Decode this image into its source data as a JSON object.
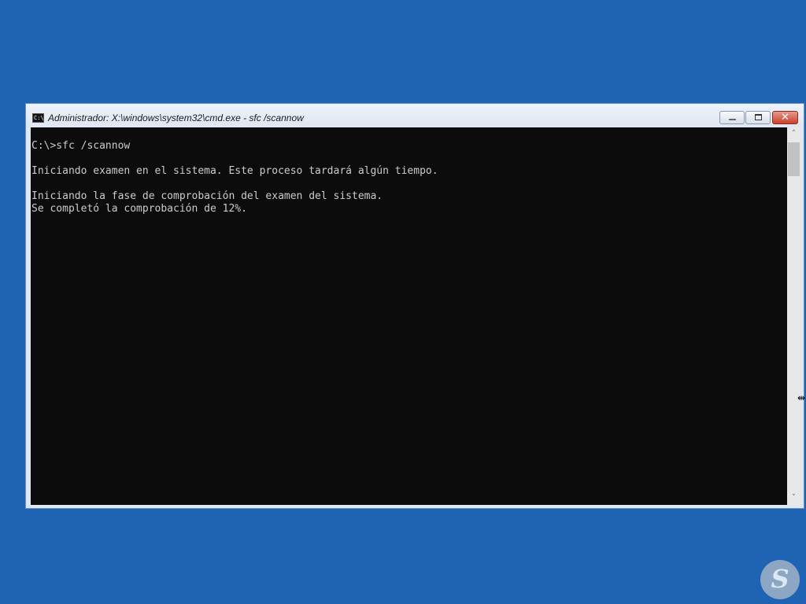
{
  "window": {
    "title": "Administrador: X:\\windows\\system32\\cmd.exe - sfc  /scannow",
    "icon": "cmd-icon",
    "icon_text": "C:\\."
  },
  "controls": {
    "minimize": "minimize-icon",
    "maximize": "maximize-icon",
    "close_symbol": "✕"
  },
  "console": {
    "lines": [
      "C:\\>sfc /scannow",
      "",
      "Iniciando examen en el sistema. Este proceso tardará algún tiempo.",
      "",
      "Iniciando la fase de comprobación del examen del sistema.",
      "Se completó la comprobación de 12%."
    ]
  },
  "scrollbar": {
    "up_arrow": "˄",
    "down_arrow": "˅"
  },
  "cursor": {
    "glyph": "⇹"
  },
  "watermark": {
    "letter": "S"
  },
  "colors": {
    "desktop": "#1f64b2",
    "console_bg": "#0c0c0c",
    "console_fg": "#cccccc",
    "close_button": "#c8402a"
  }
}
